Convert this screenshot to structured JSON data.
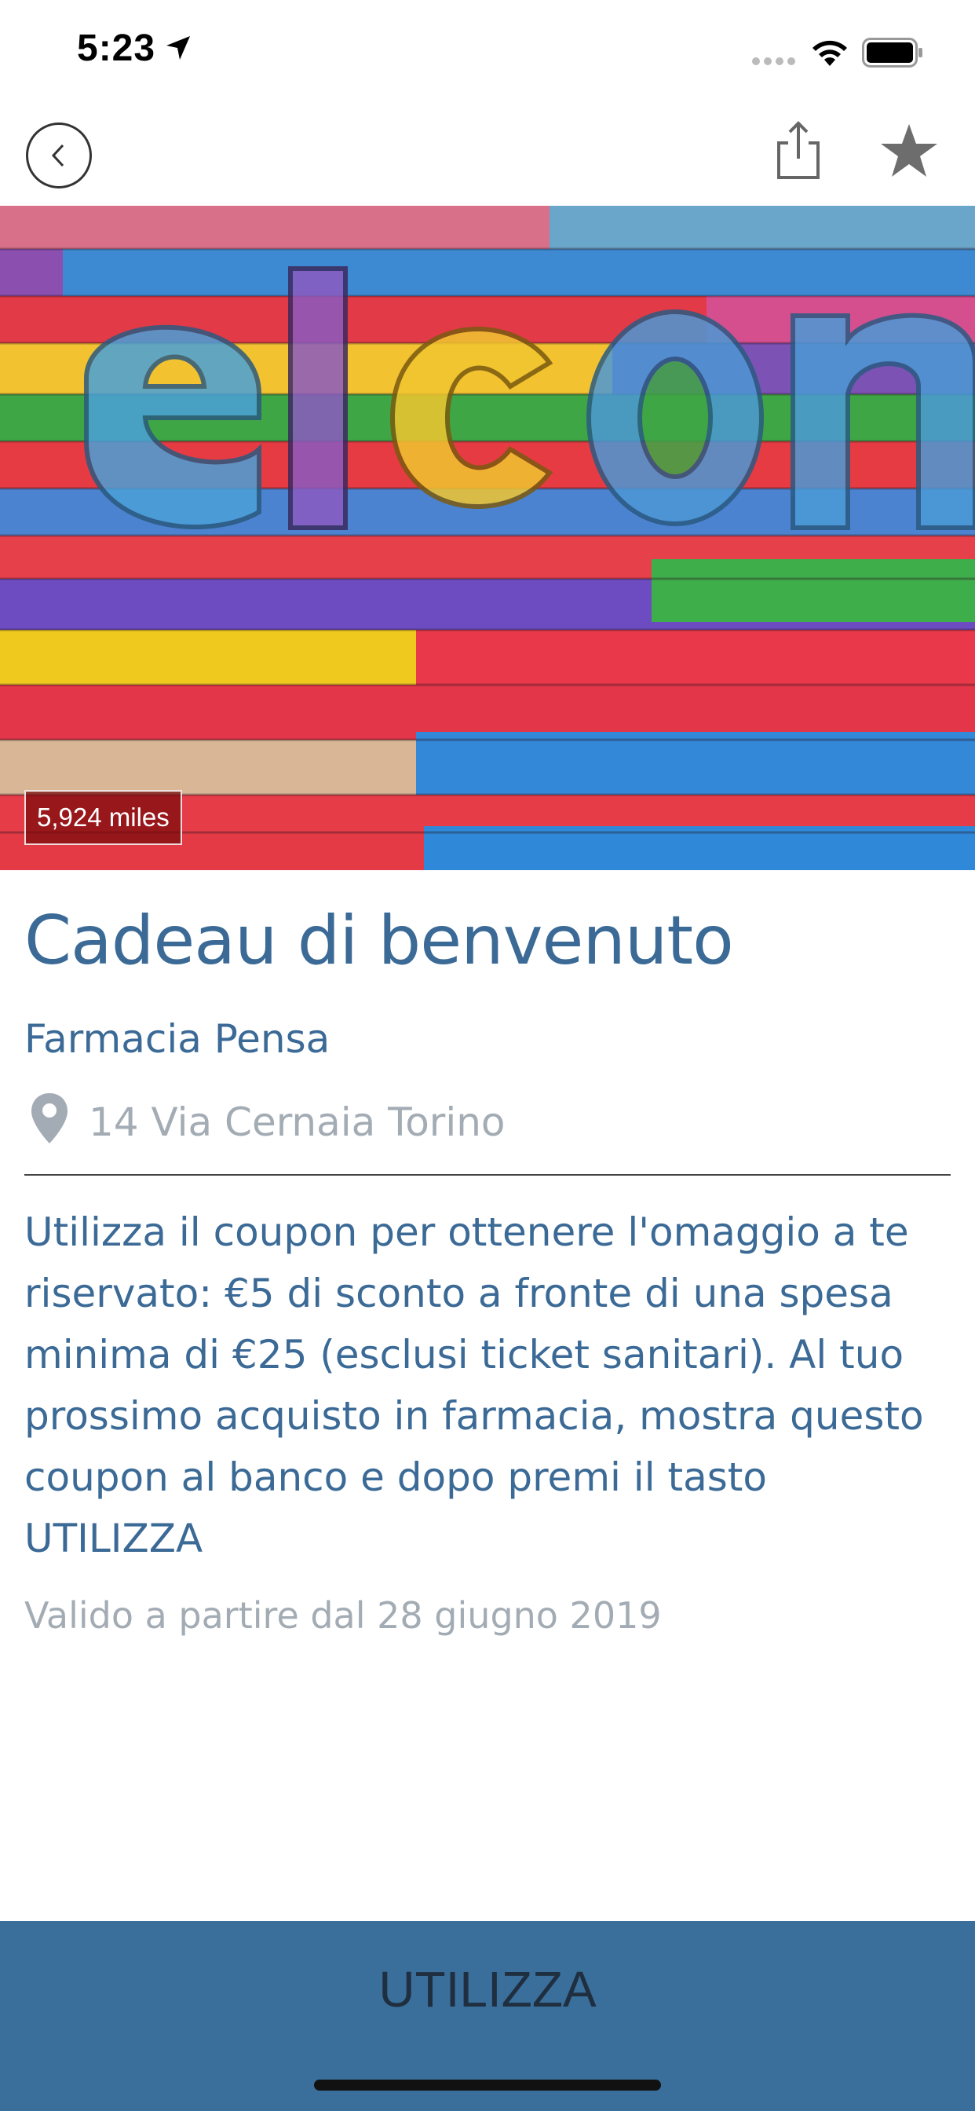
{
  "status_bar": {
    "time": "5:23"
  },
  "offer": {
    "distance": "5,924 miles",
    "title": "Cadeau di benvenuto",
    "merchant": "Farmacia Pensa",
    "address": "14 Via Cernaia Torino",
    "description": "Utilizza il coupon per ottenere l'omaggio a te riservato: €5 di sconto a fronte di una spesa minima di €25 (esclusi ticket sanitari). Al tuo prossimo acquisto in farmacia, mostra questo coupon al banco e dopo premi il tasto UTILIZZA",
    "validity": "Valido a partire dal 28 giugno 2019"
  },
  "action": {
    "use_label": "UTILIZZA"
  },
  "icons": {
    "back": "chevron-left-icon",
    "share": "share-icon",
    "favorite": "star-icon",
    "location": "map-pin-icon"
  },
  "colors": {
    "accent": "#3b6a96",
    "muted_text": "#a3acb4",
    "button_bg": "#3a6e9b"
  }
}
